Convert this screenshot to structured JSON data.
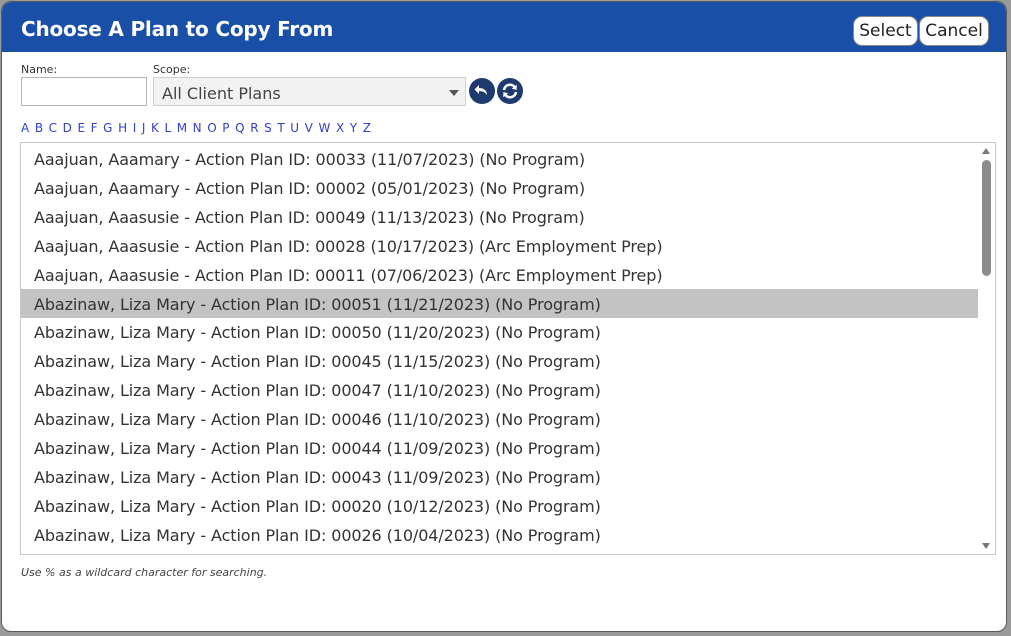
{
  "dialog": {
    "title": "Choose A Plan to Copy From",
    "select_label": "Select",
    "cancel_label": "Cancel"
  },
  "filters": {
    "name_label": "Name:",
    "name_value": "",
    "scope_label": "Scope:",
    "scope_value": "All Client Plans"
  },
  "alphabet": [
    "A",
    "B",
    "C",
    "D",
    "E",
    "F",
    "G",
    "H",
    "I",
    "J",
    "K",
    "L",
    "M",
    "N",
    "O",
    "P",
    "Q",
    "R",
    "S",
    "T",
    "U",
    "V",
    "W",
    "X",
    "Y",
    "Z"
  ],
  "plans": [
    "Aaajuan, Aaamary - Action Plan ID: 00033 (11/07/2023) (No Program)",
    "Aaajuan, Aaamary - Action Plan ID: 00002 (05/01/2023) (No Program)",
    "Aaajuan, Aaasusie - Action Plan ID: 00049 (11/13/2023) (No Program)",
    "Aaajuan, Aaasusie - Action Plan ID: 00028 (10/17/2023) (Arc Employment Prep)",
    "Aaajuan, Aaasusie - Action Plan ID: 00011 (07/06/2023) (Arc Employment Prep)",
    "Abazinaw, Liza Mary - Action Plan ID: 00051 (11/21/2023) (No Program)",
    "Abazinaw, Liza Mary - Action Plan ID: 00050 (11/20/2023) (No Program)",
    "Abazinaw, Liza Mary - Action Plan ID: 00045 (11/15/2023) (No Program)",
    "Abazinaw, Liza Mary - Action Plan ID: 00047 (11/10/2023) (No Program)",
    "Abazinaw, Liza Mary - Action Plan ID: 00046 (11/10/2023) (No Program)",
    "Abazinaw, Liza Mary - Action Plan ID: 00044 (11/09/2023) (No Program)",
    "Abazinaw, Liza Mary - Action Plan ID: 00043 (11/09/2023) (No Program)",
    "Abazinaw, Liza Mary - Action Plan ID: 00020 (10/12/2023) (No Program)",
    "Abazinaw, Liza Mary - Action Plan ID: 00026 (10/04/2023) (No Program)"
  ],
  "selected_index": 5,
  "hint": "Use % as a wildcard character for searching.",
  "icons": {
    "undo": "undo-icon",
    "refresh": "refresh-icon"
  },
  "colors": {
    "titlebar": "#1a4fa8",
    "selected_row": "#c3c3c3",
    "alpha_link": "#3340c8"
  }
}
